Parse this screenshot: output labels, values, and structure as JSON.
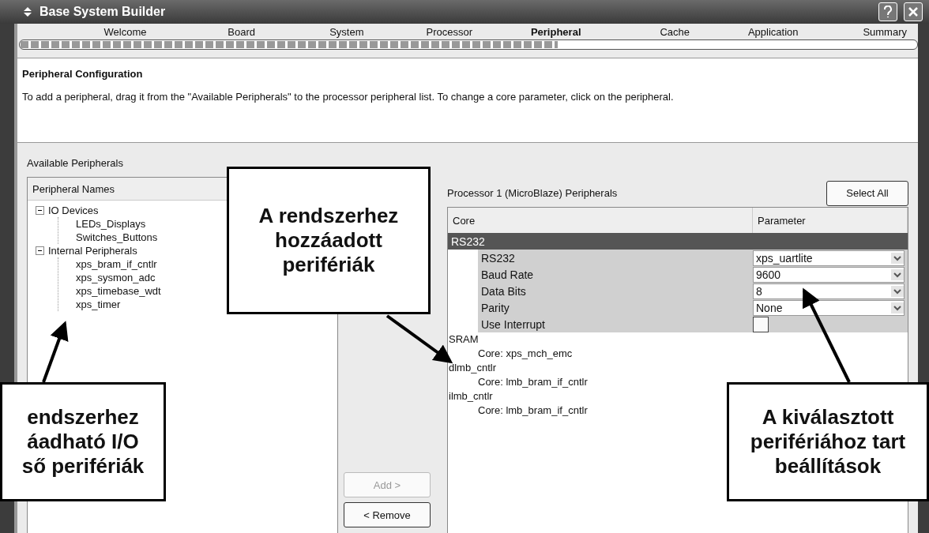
{
  "window": {
    "title": "Base System Builder"
  },
  "steps": [
    {
      "label": "Welcome",
      "selected": false
    },
    {
      "label": "Board",
      "selected": false
    },
    {
      "label": "System",
      "selected": false
    },
    {
      "label": "Processor",
      "selected": false
    },
    {
      "label": "Peripheral",
      "selected": true
    },
    {
      "label": "Cache",
      "selected": false
    },
    {
      "label": "Application",
      "selected": false
    },
    {
      "label": "Summary",
      "selected": false
    }
  ],
  "progress": {
    "level": 0.6
  },
  "header": {
    "title": "Peripheral Configuration",
    "description": "To add a peripheral, drag it from the \"Available Peripherals\" to the processor peripheral list. To change a core parameter, click on the peripheral."
  },
  "available": {
    "label": "Available Peripherals",
    "column": "Peripheral Names",
    "tree": [
      {
        "label": "IO Devices",
        "expanded": true,
        "children": [
          {
            "label": "LEDs_Displays"
          },
          {
            "label": "Switches_Buttons"
          }
        ]
      },
      {
        "label": "Internal Peripherals",
        "expanded": true,
        "children": [
          {
            "label": "xps_bram_if_cntlr"
          },
          {
            "label": "xps_sysmon_adc"
          },
          {
            "label": "xps_timebase_wdt"
          },
          {
            "label": "xps_timer"
          }
        ]
      }
    ]
  },
  "buttons": [
    {
      "label": "Add >",
      "disabled": true
    },
    {
      "label": "< Remove",
      "disabled": false
    }
  ],
  "processor": {
    "label": "Processor 1 (MicroBlaze) Peripherals",
    "select_all": "Select All",
    "columns": [
      "Core",
      "Parameter"
    ],
    "rows": [
      {
        "kind": "group",
        "name": "RS232",
        "selected": true
      },
      {
        "kind": "combo",
        "name": "RS232",
        "value": "xps_uartlite"
      },
      {
        "kind": "combo",
        "name": "Baud Rate",
        "value": "9600"
      },
      {
        "kind": "combo",
        "name": "Data Bits",
        "value": "8"
      },
      {
        "kind": "combo",
        "name": "Parity",
        "value": "None"
      },
      {
        "kind": "check",
        "name": "Use Interrupt",
        "checked": false
      },
      {
        "kind": "item",
        "name": "SRAM"
      },
      {
        "kind": "core",
        "name": "Core: xps_mch_emc"
      },
      {
        "kind": "item",
        "name": "dlmb_cntlr"
      },
      {
        "kind": "core",
        "name": "Core: lmb_bram_if_cntlr"
      },
      {
        "kind": "item",
        "name": "ilmb_cntlr"
      },
      {
        "kind": "core",
        "name": "Core: lmb_bram_if_cntlr"
      }
    ]
  },
  "callouts": [
    {
      "lines": [
        "A rendszerhez",
        "hozzáadott",
        "perifériák"
      ]
    },
    {
      "lines": [
        "endszerhez",
        "áadható I/O",
        "ső perifériák"
      ]
    },
    {
      "lines": [
        "A kiválasztott",
        "perifériához tart",
        "beállítások"
      ]
    }
  ]
}
